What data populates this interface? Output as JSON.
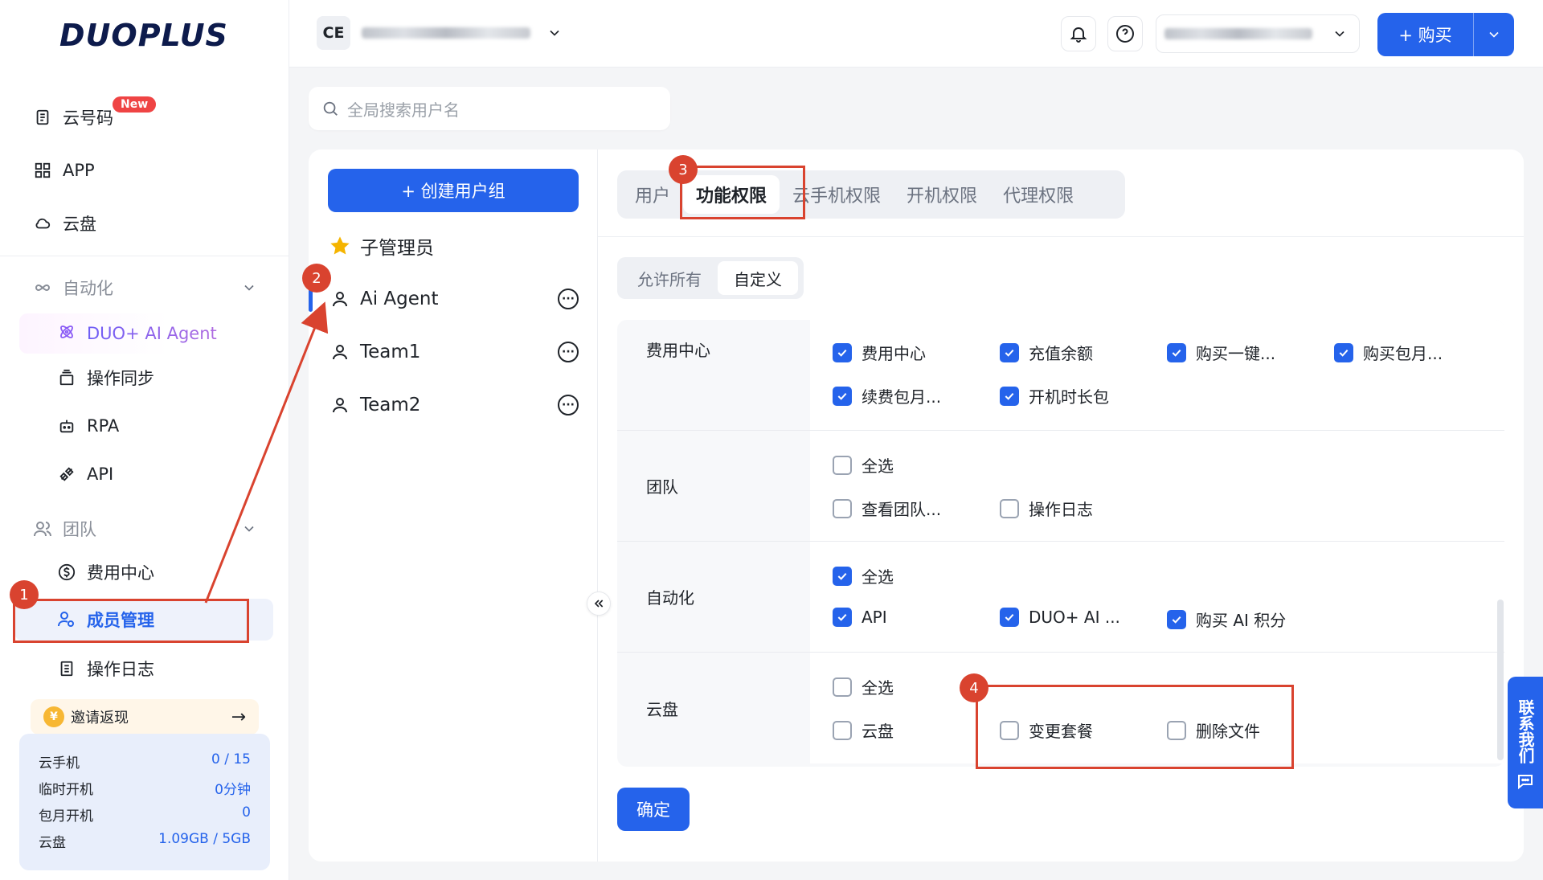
{
  "brand": {
    "logo": "DUOPLUS"
  },
  "sidebar": {
    "items": [
      {
        "label": "云号码",
        "badge": "New"
      },
      {
        "label": "APP"
      },
      {
        "label": "云盘"
      }
    ],
    "automation": {
      "label": "自动化",
      "children": [
        "DUO+ AI Agent",
        "操作同步",
        "RPA",
        "API"
      ]
    },
    "team": {
      "label": "团队",
      "children": [
        "费用中心",
        "成员管理",
        "操作日志"
      ]
    },
    "invite": {
      "label": "邀请返现",
      "arrow": "→"
    },
    "stats": [
      {
        "label": "云手机",
        "value": "0 / 15"
      },
      {
        "label": "临时开机",
        "value": "0分钟"
      },
      {
        "label": "包月开机",
        "value": "0"
      },
      {
        "label": "云盘",
        "value": "1.09GB / 5GB"
      }
    ]
  },
  "topbar": {
    "org_initials": "CE",
    "buy_label": "+ 购买"
  },
  "search": {
    "placeholder": "全局搜索用户名"
  },
  "groups": {
    "create_label": "+ 创建用户组",
    "items": [
      "子管理员",
      "Ai Agent",
      "Team1",
      "Team2"
    ]
  },
  "tabs": [
    "用户",
    "功能权限",
    "云手机权限",
    "开机权限",
    "代理权限"
  ],
  "mode": {
    "options": [
      "允许所有",
      "自定义"
    ],
    "selected": "自定义"
  },
  "permissions": [
    {
      "label": "费用中心",
      "options": [
        {
          "label": "费用中心",
          "checked": true
        },
        {
          "label": "充值余额",
          "checked": true
        },
        {
          "label": "购买一键...",
          "checked": true
        },
        {
          "label": "购买包月...",
          "checked": true
        },
        {
          "label": "续费包月...",
          "checked": true
        },
        {
          "label": "开机时长包",
          "checked": true
        }
      ]
    },
    {
      "label": "团队",
      "options": [
        {
          "label": "全选",
          "checked": false
        },
        {
          "label": "查看团队...",
          "checked": false
        },
        {
          "label": "操作日志",
          "checked": false
        }
      ]
    },
    {
      "label": "自动化",
      "options": [
        {
          "label": "全选",
          "checked": true
        },
        {
          "label": "API",
          "checked": true
        },
        {
          "label": "DUO+ AI ...",
          "checked": true
        },
        {
          "label": "购买 AI 积分",
          "checked": true
        }
      ]
    },
    {
      "label": "云盘",
      "options": [
        {
          "label": "全选",
          "checked": false
        },
        {
          "label": "云盘",
          "checked": false
        },
        {
          "label": "变更套餐",
          "checked": false
        },
        {
          "label": "删除文件",
          "checked": false
        }
      ]
    }
  ],
  "confirm_label": "确定",
  "contact_label": "联系我们",
  "annotations": [
    "1",
    "2",
    "3",
    "4"
  ],
  "colors": {
    "primary": "#2563eb",
    "annotation": "#d9432f"
  }
}
